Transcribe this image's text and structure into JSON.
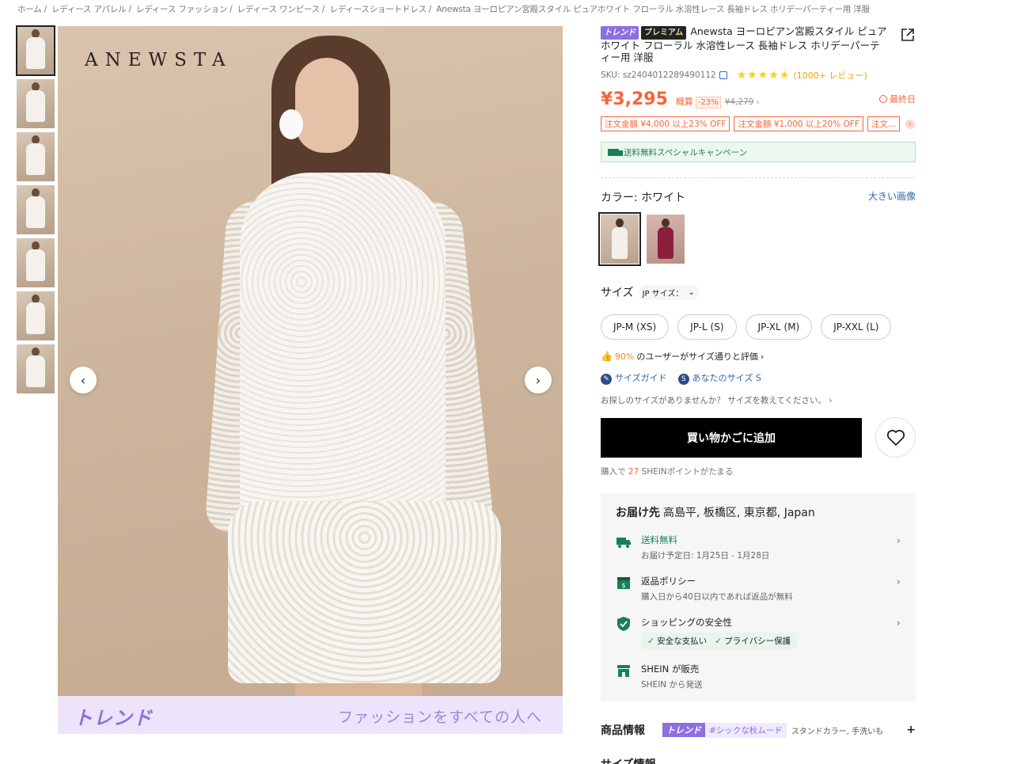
{
  "breadcrumb": [
    "ホーム",
    "レディース アパレル",
    "レディース ファッション",
    "レディース ワンピース",
    "レディースショートドレス",
    "Anewsta ヨーロピアン宮殿スタイル ピュアホワイト フローラル 水溶性レース 長袖ドレス ホリデーパーティー用 洋服"
  ],
  "gallery": {
    "brand_logo": "ANEWSTA",
    "banner_trend": "トレンド",
    "banner_tagline": "ファッションをすべての人へ",
    "prev": "‹",
    "next": "›"
  },
  "product": {
    "badge_trend": "トレンド",
    "badge_premium": "プレミアム",
    "title": "Anewsta ヨーロピアン宮殿スタイル ピュアホワイト フローラル 水溶性レース 長袖ドレス ホリデーパーティー用 洋服",
    "sku": "SKU: sz2404012289490112",
    "rating_stars": "★★★★★",
    "rating": 4.5,
    "reviews": "(1000+ レビュー)",
    "price": "¥3,295",
    "est_label": "概算",
    "discount": "-23%",
    "original_price": "¥4,279",
    "last_day": "最終日",
    "coupons": [
      "注文金額 ¥4,000 以上23% OFF",
      "注文金額 ¥1,000 以上20% OFF",
      "注文..."
    ],
    "shipping_banner": "送料無料スペシャルキャンペーン",
    "color_label": "カラー:",
    "color_value": "ホワイト",
    "big_image_link": "大きい画像",
    "size_label": "サイズ",
    "size_select": "JP サイズ：",
    "sizes": [
      "JP-M (XS)",
      "JP-L (S)",
      "JP-XL (M)",
      "JP-XXL (L)"
    ],
    "fit_pct": "90%",
    "fit_text": "のユーザーがサイズ通りと評価",
    "size_guide": "サイズガイド",
    "your_size": "あなたのサイズ S",
    "not_found": "お探しのサイズがありませんか？ サイズを教えてください。",
    "add_to_cart": "買い物かごに追加",
    "points_prefix": "購入で",
    "points_value": "27",
    "points_suffix": "SHEINポイントがたまる"
  },
  "delivery": {
    "label": "お届け先",
    "address": "高島平, 板橋区, 東京都, Japan",
    "items": [
      {
        "title": "送料無料",
        "sub": "お届け予定日: 1月25日 - 1月28日"
      },
      {
        "title": "返品ポリシー",
        "sub": "購入日から40日以内であれば返品が無料"
      },
      {
        "title": "ショッピングの安全性",
        "tags": [
          "安全な支払い",
          "プライバシー保護"
        ]
      },
      {
        "title": "SHEIN が販売",
        "sub": "SHEIN から発送"
      }
    ]
  },
  "product_info": {
    "heading": "商品情報",
    "badge": "トレンド",
    "tag": "#シックな秋ムード",
    "desc": "スタンドカラー, 手洗いも...",
    "plus": "+"
  },
  "size_info": {
    "heading": "サイズ情報"
  },
  "colors": {
    "accent": "#fa6338",
    "trend": "#8c6fe0",
    "green": "#198055",
    "link": "#2d68a8"
  }
}
